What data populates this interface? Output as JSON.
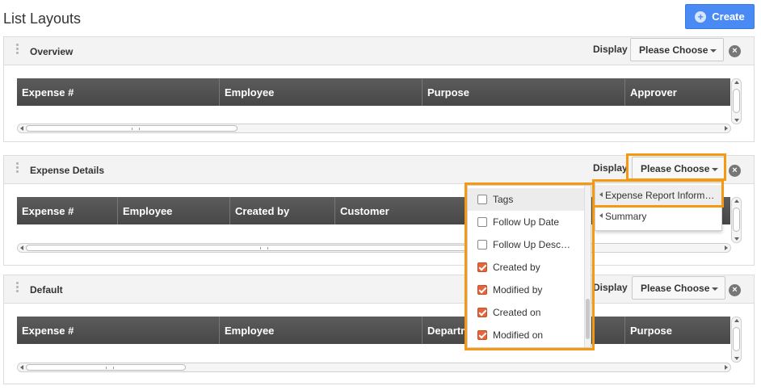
{
  "page": {
    "title": "List Layouts",
    "create_label": "Create"
  },
  "panels": [
    {
      "title": "Overview",
      "display_label": "Display",
      "select_value": "Please Choose",
      "columns": [
        "Expense #",
        "Employee",
        "Purpose",
        "Approver"
      ]
    },
    {
      "title": "Expense Details",
      "display_label": "Display",
      "select_value": "Please Choose",
      "columns": [
        "Expense #",
        "Employee",
        "Created by",
        "Customer"
      ]
    },
    {
      "title": "Default",
      "display_label": "Display",
      "select_value": "Please Choose",
      "columns": [
        "Expense #",
        "Employee",
        "Departm",
        "Purpose"
      ]
    }
  ],
  "field_list": [
    {
      "label": "Tags",
      "checked": false
    },
    {
      "label": "Follow Up Date",
      "checked": false
    },
    {
      "label": "Follow Up Desc…",
      "checked": false
    },
    {
      "label": "Created by",
      "checked": true
    },
    {
      "label": "Modified by",
      "checked": true
    },
    {
      "label": "Created on",
      "checked": true
    },
    {
      "label": "Modified on",
      "checked": true
    }
  ],
  "layout_menu": [
    {
      "label": "Expense Report Inform…"
    },
    {
      "label": "Summary"
    }
  ],
  "colors": {
    "accent": "#4a8af4",
    "highlight": "#f39a12",
    "checkbox": "#e8643a",
    "grid_header": "#4f4f4f"
  },
  "icons": {
    "create": "plus-circle-icon",
    "close": "close-icon",
    "drag": "drag-handle-icon",
    "caret": "chevron-down-icon"
  }
}
